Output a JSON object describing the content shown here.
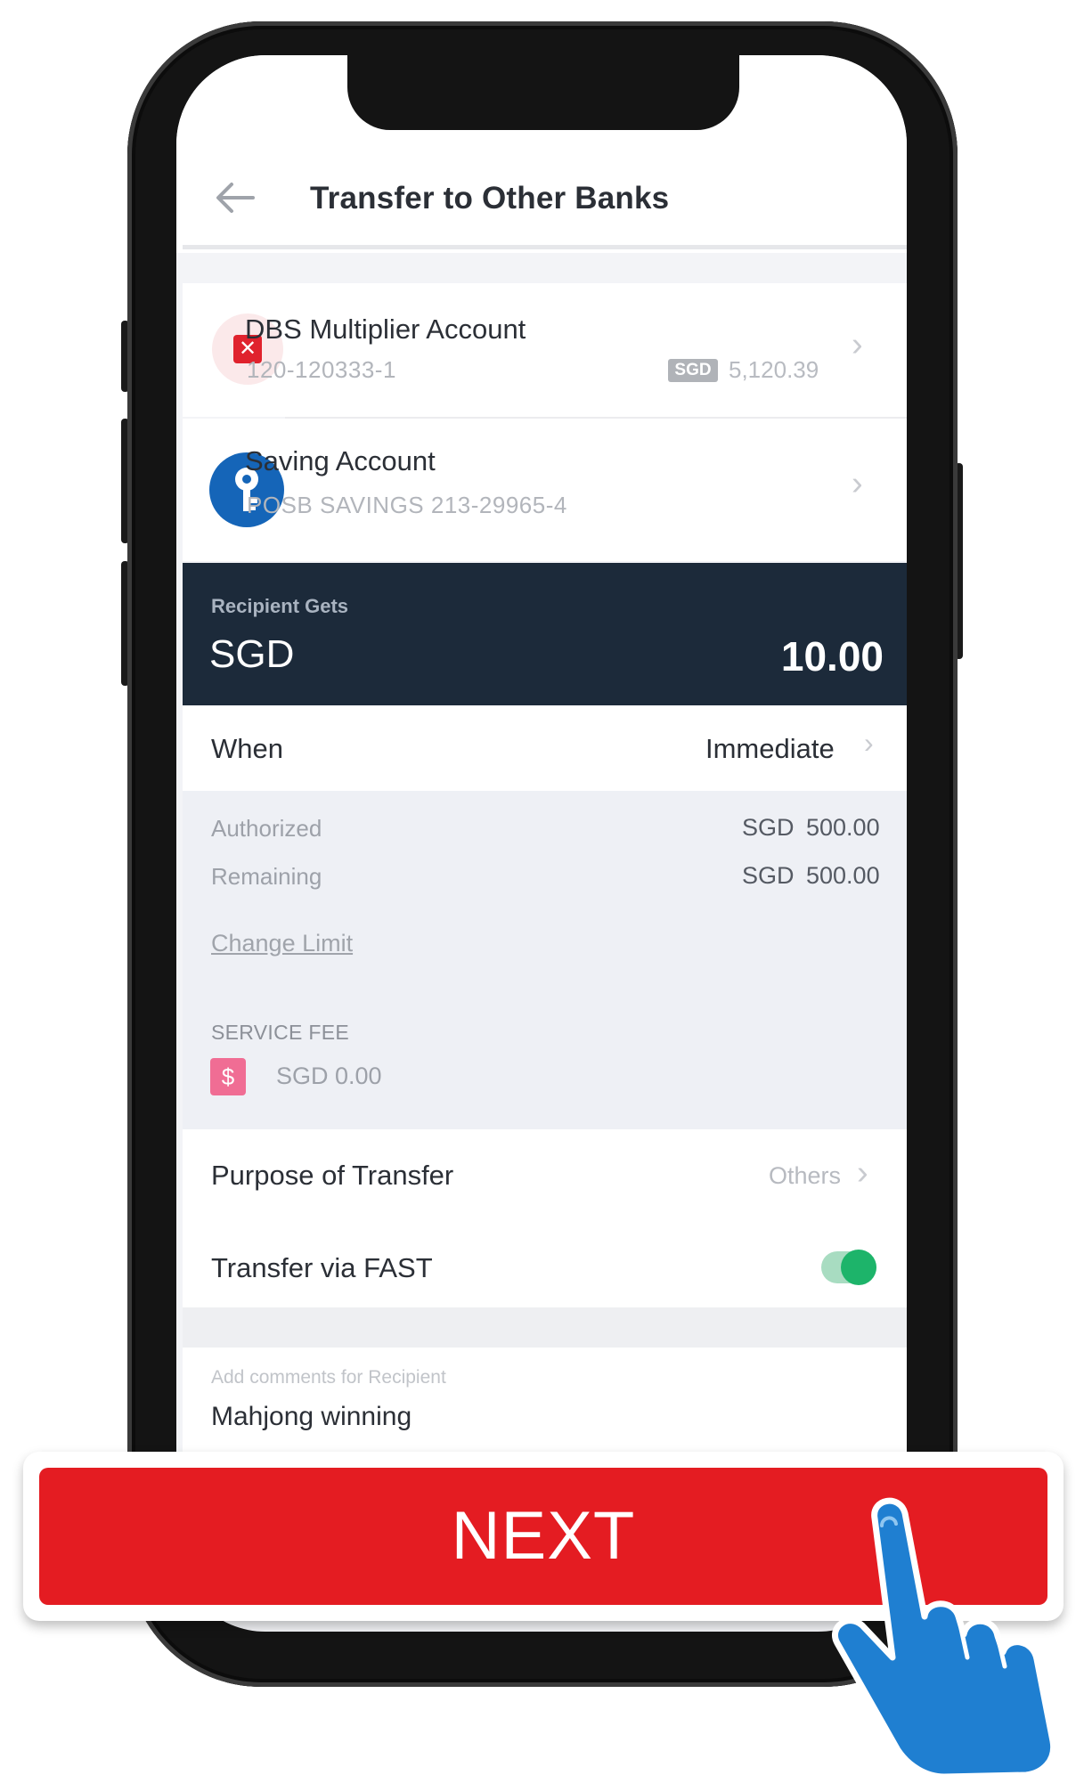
{
  "header": {
    "title": "Transfer to Other Banks"
  },
  "from_account": {
    "name": "DBS Multiplier Account",
    "number": "120-120333-1",
    "currency_badge": "SGD",
    "balance": "5,120.39"
  },
  "to_account": {
    "name": "Saving Account",
    "number": "POSB SAVINGS 213-29965-4"
  },
  "amount": {
    "label": "Recipient Gets",
    "currency": "SGD",
    "value": "10.00"
  },
  "when": {
    "label": "When",
    "value": "Immediate"
  },
  "limits": {
    "authorized_label": "Authorized",
    "authorized_ccy": "SGD",
    "authorized_value": "500.00",
    "remaining_label": "Remaining",
    "remaining_ccy": "SGD",
    "remaining_value": "500.00",
    "change_link": "Change Limit"
  },
  "service_fee": {
    "label": "SERVICE FEE",
    "icon": "$",
    "value": "SGD 0.00"
  },
  "purpose": {
    "label": "Purpose of Transfer",
    "value": "Others"
  },
  "fast": {
    "label": "Transfer via FAST",
    "enabled": true
  },
  "comments": {
    "label": "Add comments for Recipient",
    "value": "Mahjong winning"
  },
  "next_button": {
    "label": "NEXT"
  },
  "colors": {
    "primary_red": "#e41c22",
    "panel_dark": "#1c2a3a",
    "toggle_green": "#1db46a",
    "hand_blue": "#1f7fd1"
  }
}
